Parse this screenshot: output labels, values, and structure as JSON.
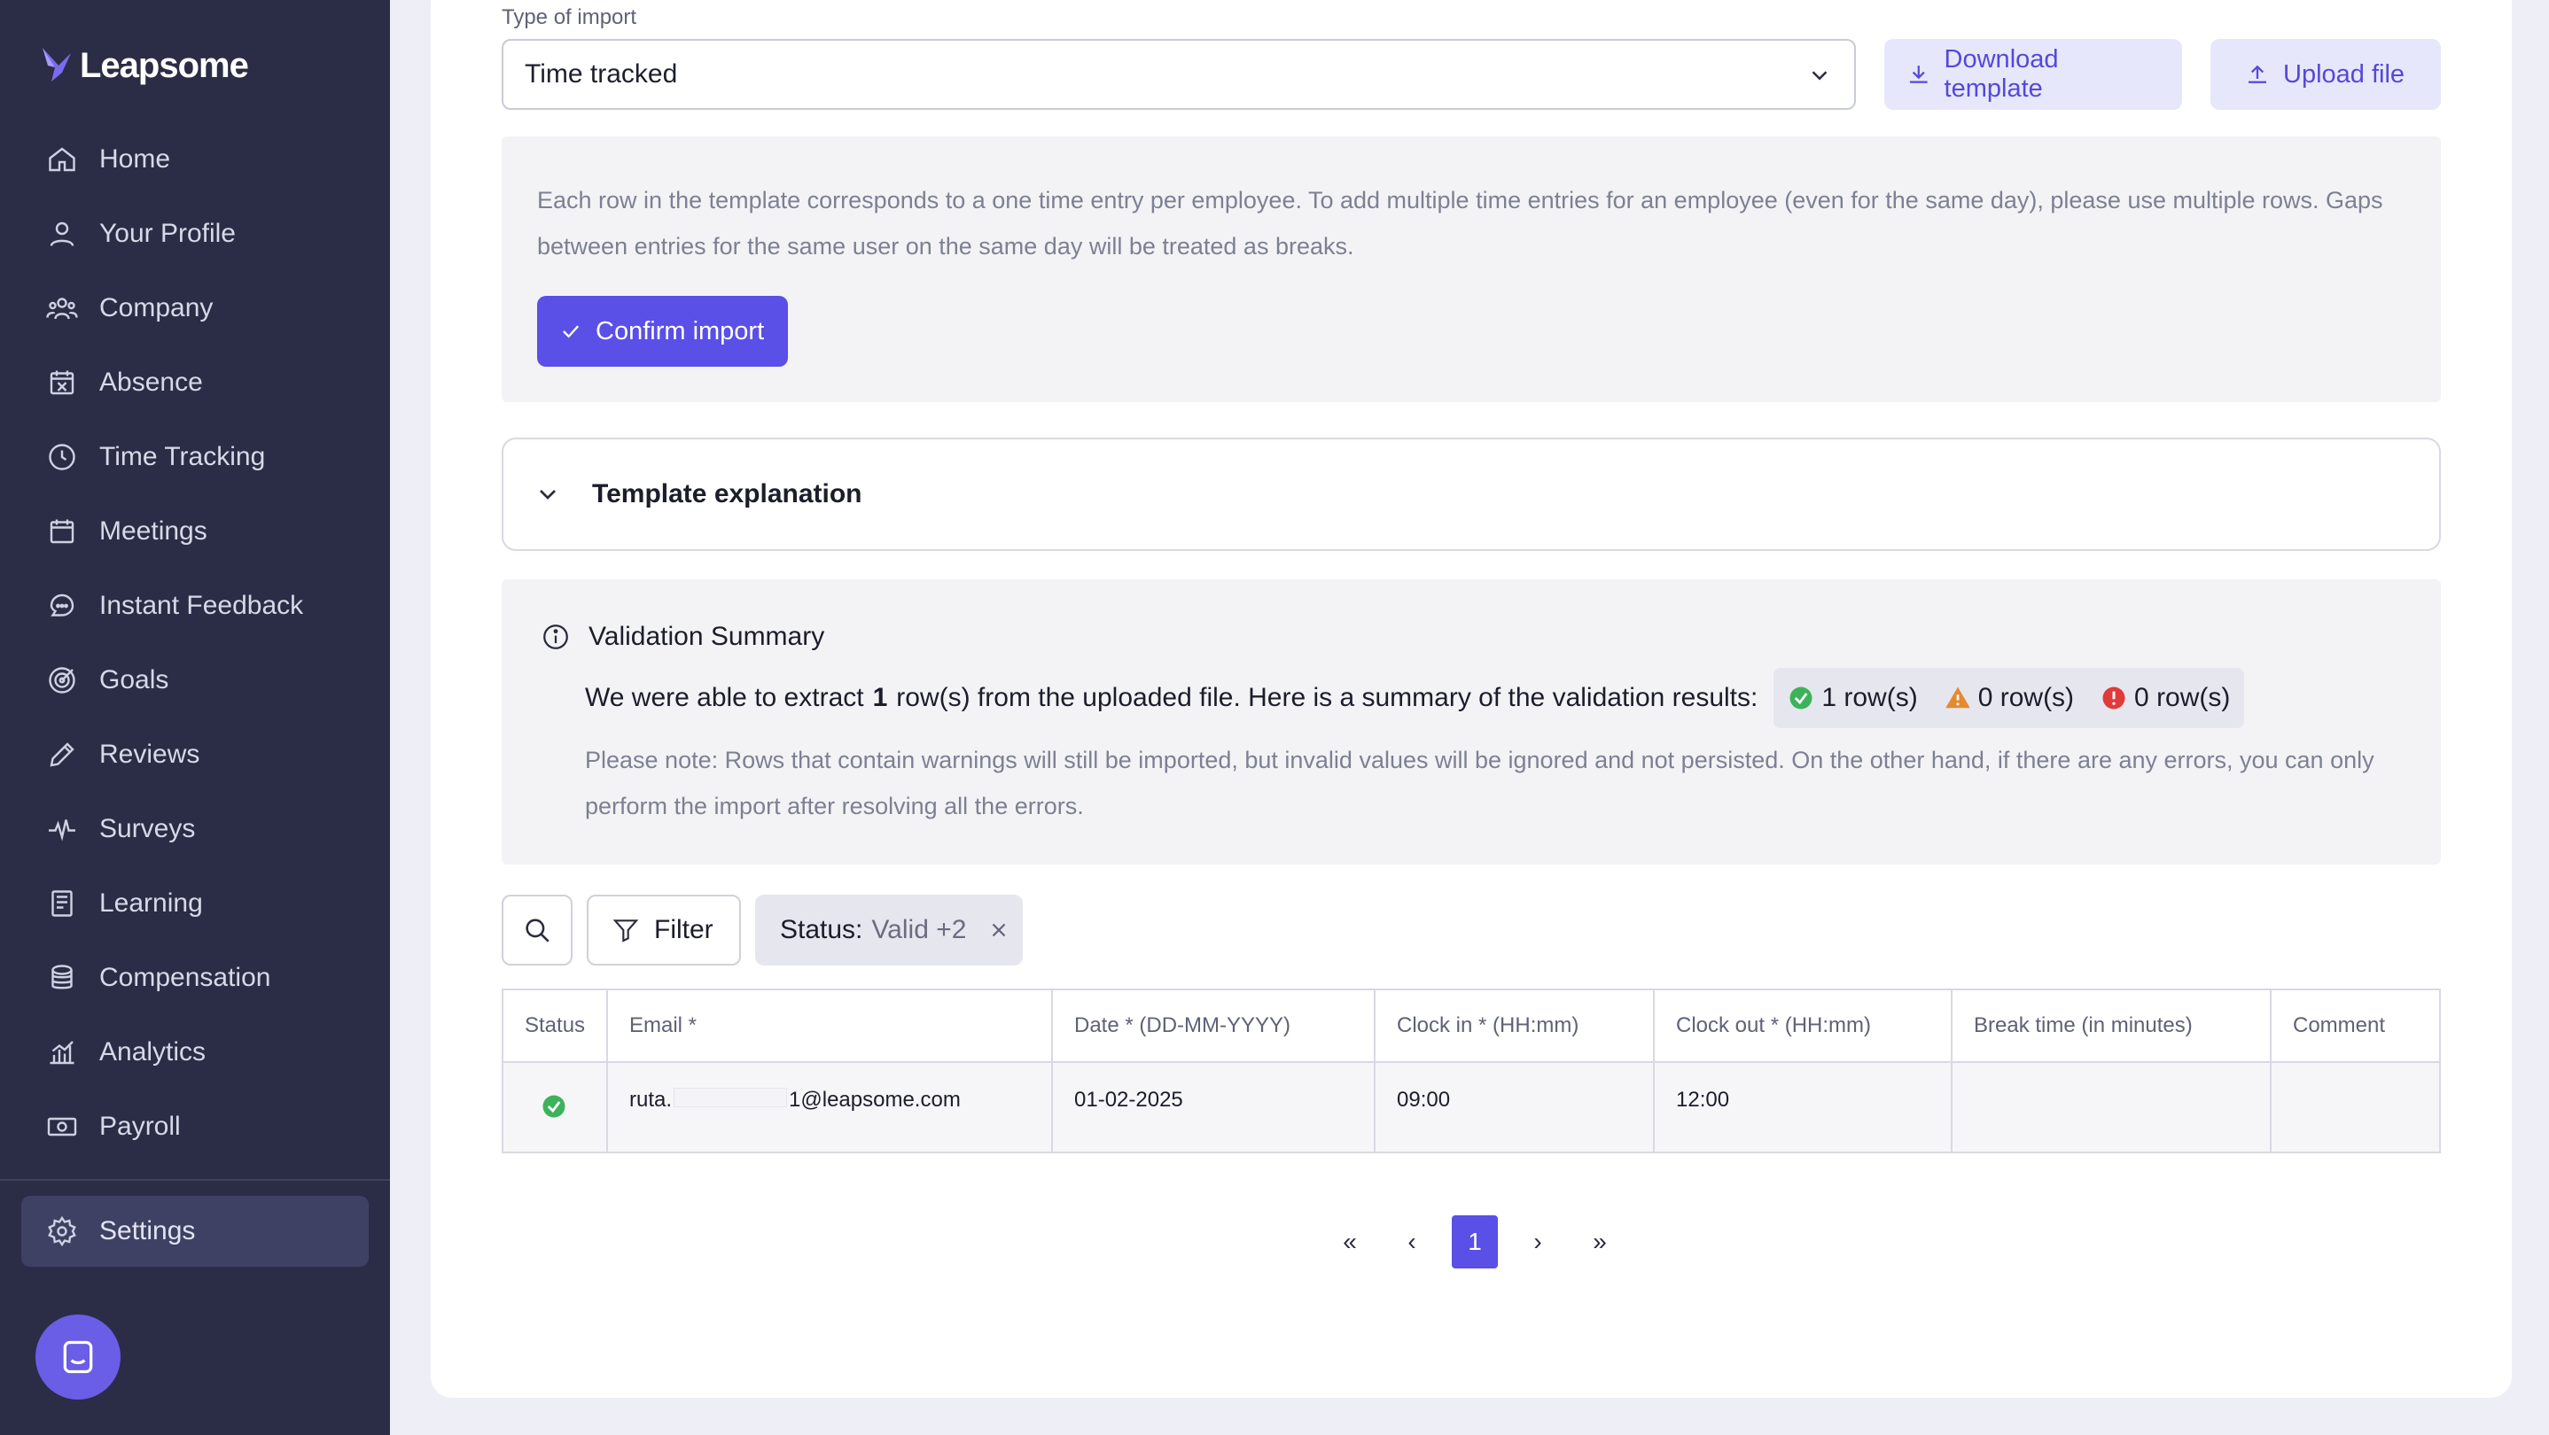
{
  "app": {
    "name": "Leapsome"
  },
  "sidebar": {
    "items": [
      {
        "label": "Home",
        "icon": "home-icon"
      },
      {
        "label": "Your Profile",
        "icon": "user-icon"
      },
      {
        "label": "Company",
        "icon": "users-icon"
      },
      {
        "label": "Absence",
        "icon": "calendar-x-icon"
      },
      {
        "label": "Time Tracking",
        "icon": "clock-icon"
      },
      {
        "label": "Meetings",
        "icon": "calendar-icon"
      },
      {
        "label": "Instant Feedback",
        "icon": "chat-icon"
      },
      {
        "label": "Goals",
        "icon": "target-icon"
      },
      {
        "label": "Reviews",
        "icon": "pencil-icon"
      },
      {
        "label": "Surveys",
        "icon": "pulse-icon"
      },
      {
        "label": "Learning",
        "icon": "book-icon"
      },
      {
        "label": "Compensation",
        "icon": "coins-icon"
      },
      {
        "label": "Analytics",
        "icon": "chart-icon"
      },
      {
        "label": "Payroll",
        "icon": "money-icon"
      }
    ],
    "settings_label": "Settings"
  },
  "import": {
    "type_label": "Type of import",
    "type_value": "Time tracked",
    "download_label": "Download template",
    "upload_label": "Upload file",
    "info_text": "Each row in the template corresponds to a one time entry per employee. To add multiple time entries for an employee (even for the same day), please use multiple rows. Gaps between entries for the same user on the same day will be treated as breaks.",
    "confirm_label": "Confirm import",
    "template_explanation": "Template explanation"
  },
  "validation": {
    "title": "Validation Summary",
    "line_prefix": "We were able to extract",
    "line_count": "1",
    "line_suffix": "row(s) from the uploaded file. Here is a summary of the validation results:",
    "valid": "1 row(s)",
    "warnings": "0 row(s)",
    "errors": "0 row(s)",
    "note": "Please note: Rows that contain warnings will still be imported, but invalid values will be ignored and not persisted. On the other hand, if there are any errors, you can only perform the import after resolving all the errors."
  },
  "filters": {
    "filter_label": "Filter",
    "chip_key": "Status:",
    "chip_value": "Valid +2"
  },
  "table": {
    "headers": [
      "Status",
      "Email *",
      "Date * (DD-MM-YYYY)",
      "Clock in * (HH:mm)",
      "Clock out * (HH:mm)",
      "Break time (in minutes)",
      "Comment"
    ],
    "rows": [
      {
        "email_start": "ruta.",
        "email_end": "1@leapsome.com",
        "date": "01-02-2025",
        "clock_in": "09:00",
        "clock_out": "12:00",
        "break": "",
        "comment": ""
      }
    ]
  },
  "pagination": {
    "first": "«",
    "prev": "‹",
    "current": "1",
    "next": "›",
    "last": "»"
  },
  "colors": {
    "sidebar": "#2b2d46",
    "accent": "#5a4fe6",
    "success": "#3cb35a",
    "warning": "#e58a2f",
    "error": "#e03a3a"
  }
}
